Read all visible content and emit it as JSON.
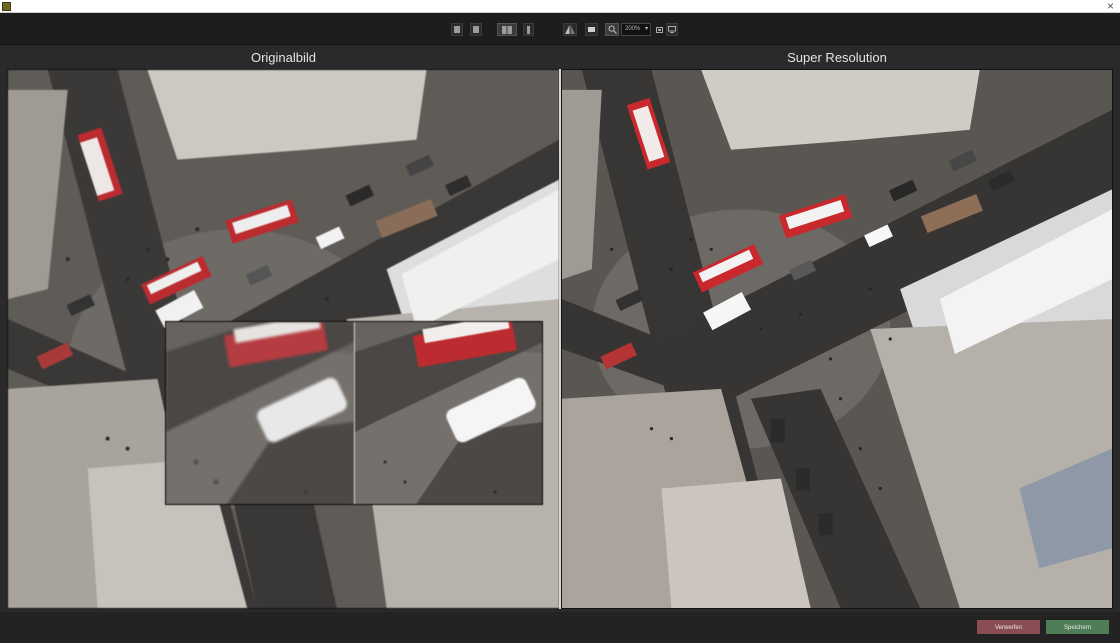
{
  "window": {
    "close_glyph": "×",
    "icon": "app-icon"
  },
  "toolbar": {
    "buttons": [
      {
        "name": "view-single-left",
        "icon": "square-icon"
      },
      {
        "name": "view-single-right",
        "icon": "square-icon"
      },
      {
        "name": "view-split",
        "icon": "split-view-icon",
        "active": true
      },
      {
        "name": "view-single-narrow",
        "icon": "narrow-rect-icon"
      },
      {
        "name": "compare-mirror",
        "icon": "mirror-triangles-icon"
      },
      {
        "name": "rect-view",
        "icon": "rectangle-icon"
      },
      {
        "name": "zoom-tool",
        "icon": "magnifier-icon"
      },
      {
        "name": "fit-button",
        "icon": "fit-icon"
      },
      {
        "name": "fullscreen-button",
        "icon": "monitor-icon"
      }
    ],
    "zoom": {
      "value": "200%",
      "caret": "▾"
    }
  },
  "panes": {
    "left_title": "Originalbild",
    "right_title": "Super Resolution"
  },
  "footer": {
    "discard_label": "Verwerfen",
    "save_label": "Speichern"
  },
  "colors": {
    "bus_red": "#c9282c",
    "road": "#3a3836",
    "plaza": "#6d6964",
    "building": "#cfcac3",
    "roof": "#dcdcdc",
    "discard": "#8a4d53",
    "save": "#4f7d57"
  }
}
